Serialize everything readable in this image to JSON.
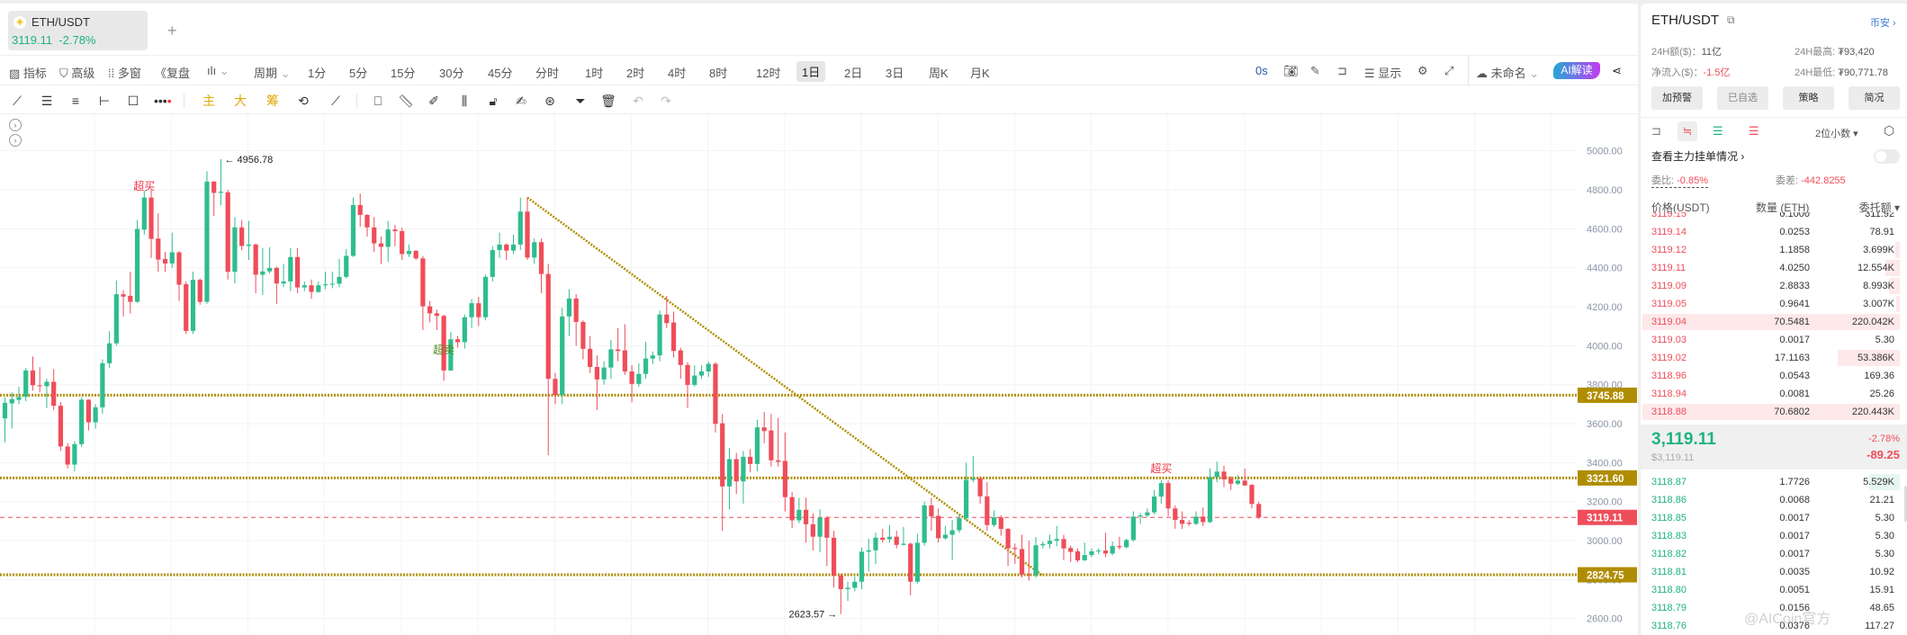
{
  "tab": {
    "symbol": "ETH/USDT",
    "price": "3119.11",
    "change": "-2.78%",
    "add": "+"
  },
  "toolbar1": {
    "indicators": "指标",
    "advanced": "高级",
    "multi_window": "多窗",
    "replay": "复盘",
    "period": "周期",
    "periods": [
      "1分",
      "5分",
      "15分",
      "30分",
      "45分",
      "分时",
      "1时",
      "2时",
      "4时",
      "8时",
      "12时",
      "1日",
      "2日",
      "3日",
      "周K",
      "月K"
    ],
    "selected_period": "1日",
    "countdown": "0s",
    "display": "显示",
    "layout_name": "未命名",
    "ai_button": "AI解读"
  },
  "toolbar2": {
    "main": "主",
    "big": "大",
    "chips": "筹"
  },
  "chart_data": {
    "type": "candlestick",
    "symbol": "ETH/USDT",
    "interval": "1日",
    "ylim": [
      2560,
      5060
    ],
    "yticks": [
      "5000.00",
      "4800.00",
      "4600.00",
      "4400.00",
      "4200.00",
      "4000.00",
      "3800.00",
      "3600.00",
      "3400.00",
      "3200.00",
      "3000.00",
      "2800.00",
      "2600.00"
    ],
    "ohlc": [
      [
        3627,
        3735,
        3505,
        3707
      ],
      [
        3704,
        3760,
        3575,
        3726
      ],
      [
        3722,
        3790,
        3700,
        3737
      ],
      [
        3738,
        3885,
        3715,
        3873
      ],
      [
        3873,
        3945,
        3770,
        3797
      ],
      [
        3797,
        3890,
        3760,
        3792
      ],
      [
        3792,
        3830,
        3680,
        3815
      ],
      [
        3815,
        3880,
        3670,
        3692
      ],
      [
        3692,
        3712,
        3460,
        3483
      ],
      [
        3483,
        3500,
        3370,
        3390
      ],
      [
        3390,
        3510,
        3355,
        3495
      ],
      [
        3495,
        3735,
        3480,
        3723
      ],
      [
        3723,
        3725,
        3565,
        3607
      ],
      [
        3607,
        3700,
        3575,
        3684
      ],
      [
        3684,
        3930,
        3650,
        3910
      ],
      [
        3910,
        4075,
        3885,
        4012
      ],
      [
        4012,
        4335,
        4000,
        4264
      ],
      [
        4264,
        4285,
        4150,
        4252
      ],
      [
        4256,
        4380,
        4165,
        4225
      ],
      [
        4225,
        4645,
        4220,
        4599
      ],
      [
        4595,
        4795,
        4570,
        4760
      ],
      [
        4760,
        4800,
        4450,
        4548
      ],
      [
        4550,
        4680,
        4380,
        4442
      ],
      [
        4445,
        4480,
        4380,
        4422
      ],
      [
        4422,
        4580,
        4400,
        4479
      ],
      [
        4479,
        4485,
        4230,
        4313
      ],
      [
        4316,
        4330,
        4060,
        4076
      ],
      [
        4076,
        4380,
        4060,
        4338
      ],
      [
        4338,
        4345,
        4210,
        4225
      ],
      [
        4225,
        4895,
        4215,
        4842
      ],
      [
        4842,
        4845,
        4665,
        4784
      ],
      [
        4784,
        4956.78,
        4720,
        4790
      ],
      [
        4787,
        4800,
        4340,
        4379
      ],
      [
        4379,
        4660,
        4320,
        4607
      ],
      [
        4607,
        4645,
        4490,
        4512
      ],
      [
        4512,
        4640,
        4440,
        4519
      ],
      [
        4519,
        4525,
        4270,
        4364
      ],
      [
        4364,
        4500,
        4260,
        4381
      ],
      [
        4381,
        4505,
        4370,
        4399
      ],
      [
        4399,
        4405,
        4215,
        4319
      ],
      [
        4319,
        4420,
        4300,
        4330
      ],
      [
        4330,
        4500,
        4280,
        4455
      ],
      [
        4455,
        4500,
        4270,
        4299
      ],
      [
        4299,
        4330,
        4280,
        4310
      ],
      [
        4310,
        4340,
        4240,
        4276
      ],
      [
        4276,
        4330,
        4270,
        4310
      ],
      [
        4310,
        4380,
        4290,
        4315
      ],
      [
        4315,
        4380,
        4295,
        4318
      ],
      [
        4318,
        4445,
        4300,
        4353
      ],
      [
        4353,
        4495,
        4345,
        4461
      ],
      [
        4461,
        4760,
        4455,
        4722
      ],
      [
        4722,
        4780,
        4610,
        4671
      ],
      [
        4671,
        4675,
        4560,
        4607
      ],
      [
        4607,
        4660,
        4480,
        4525
      ],
      [
        4525,
        4560,
        4420,
        4507
      ],
      [
        4507,
        4640,
        4430,
        4596
      ],
      [
        4596,
        4620,
        4510,
        4588
      ],
      [
        4588,
        4605,
        4440,
        4470
      ],
      [
        4470,
        4520,
        4455,
        4487
      ],
      [
        4487,
        4490,
        4440,
        4448
      ],
      [
        4448,
        4460,
        4080,
        4202
      ],
      [
        4202,
        4230,
        4120,
        4166
      ],
      [
        4166,
        4185,
        4080,
        4153
      ],
      [
        4153,
        4160,
        3820,
        3873
      ],
      [
        3873,
        4070,
        3870,
        4033
      ],
      [
        4033,
        4050,
        3990,
        4018
      ],
      [
        4018,
        4160,
        3985,
        4146
      ],
      [
        4146,
        4240,
        4090,
        4218
      ],
      [
        4218,
        4250,
        4100,
        4146
      ],
      [
        4146,
        4365,
        4130,
        4353
      ],
      [
        4353,
        4510,
        4330,
        4491
      ],
      [
        4491,
        4580,
        4450,
        4519
      ],
      [
        4519,
        4525,
        4440,
        4488
      ],
      [
        4488,
        4570,
        4470,
        4519
      ],
      [
        4519,
        4760,
        4490,
        4688
      ],
      [
        4688,
        4760,
        4440,
        4452
      ],
      [
        4452,
        4550,
        4420,
        4531
      ],
      [
        4531,
        4550,
        4270,
        4368
      ],
      [
        4368,
        4420,
        3438,
        3830
      ],
      [
        3830,
        3860,
        3700,
        3747
      ],
      [
        3747,
        4195,
        3700,
        4150
      ],
      [
        4150,
        4290,
        4050,
        4242
      ],
      [
        4242,
        4265,
        4000,
        4122
      ],
      [
        4122,
        4130,
        3930,
        3984
      ],
      [
        3984,
        4050,
        3860,
        3891
      ],
      [
        3891,
        3950,
        3670,
        3827
      ],
      [
        3827,
        3920,
        3800,
        3888
      ],
      [
        3888,
        4030,
        3830,
        3981
      ],
      [
        3981,
        4090,
        3920,
        3973
      ],
      [
        3976,
        4110,
        3850,
        3868
      ],
      [
        3868,
        3900,
        3710,
        3804
      ],
      [
        3804,
        3910,
        3790,
        3855
      ],
      [
        3855,
        4020,
        3830,
        3934
      ],
      [
        3934,
        3970,
        3905,
        3950
      ],
      [
        3950,
        4180,
        3920,
        4160
      ],
      [
        4160,
        4255,
        4090,
        4116
      ],
      [
        4119,
        4175,
        3940,
        3973
      ],
      [
        3976,
        3990,
        3830,
        3901
      ],
      [
        3901,
        3915,
        3680,
        3799
      ],
      [
        3799,
        3900,
        3790,
        3847
      ],
      [
        3847,
        3900,
        3830,
        3868
      ],
      [
        3868,
        3920,
        3840,
        3907
      ],
      [
        3907,
        3915,
        3555,
        3599
      ],
      [
        3602,
        3650,
        3050,
        3278
      ],
      [
        3278,
        3475,
        3160,
        3418
      ],
      [
        3418,
        3450,
        3240,
        3304
      ],
      [
        3304,
        3460,
        3190,
        3430
      ],
      [
        3430,
        3470,
        3350,
        3393
      ],
      [
        3393,
        3620,
        3355,
        3581
      ],
      [
        3581,
        3660,
        3500,
        3562
      ],
      [
        3565,
        3650,
        3380,
        3412
      ],
      [
        3412,
        3630,
        3380,
        3404
      ],
      [
        3409,
        3555,
        3150,
        3223
      ],
      [
        3223,
        3250,
        3065,
        3104
      ],
      [
        3104,
        3220,
        3090,
        3158
      ],
      [
        3158,
        3220,
        2990,
        3084
      ],
      [
        3084,
        3140,
        2950,
        3020
      ],
      [
        3020,
        3160,
        2940,
        3117
      ],
      [
        3117,
        3125,
        2870,
        3015
      ],
      [
        3015,
        3050,
        2760,
        2820
      ],
      [
        2820,
        2830,
        2623.57,
        2751
      ],
      [
        2751,
        2790,
        2690,
        2758
      ],
      [
        2758,
        2815,
        2740,
        2789
      ],
      [
        2789,
        2965,
        2750,
        2943
      ],
      [
        2943,
        3010,
        2840,
        2950
      ],
      [
        2950,
        3040,
        2880,
        3015
      ],
      [
        3015,
        3060,
        2990,
        3004
      ],
      [
        3007,
        3080,
        2990,
        3020
      ],
      [
        3020,
        3050,
        2960,
        2978
      ],
      [
        2978,
        3070,
        2975,
        2984
      ],
      [
        2984,
        2990,
        2720,
        2789
      ],
      [
        2789,
        3035,
        2780,
        2989
      ],
      [
        2989,
        3200,
        2975,
        3181
      ],
      [
        3181,
        3220,
        3050,
        3124
      ],
      [
        3127,
        3165,
        2990,
        3012
      ],
      [
        3012,
        3075,
        3005,
        3030
      ],
      [
        3030,
        3105,
        2900,
        3053
      ],
      [
        3053,
        3135,
        3040,
        3115
      ],
      [
        3115,
        3400,
        3100,
        3312
      ],
      [
        3312,
        3435,
        3300,
        3320
      ],
      [
        3320,
        3330,
        3190,
        3227
      ],
      [
        3227,
        3300,
        3050,
        3080
      ],
      [
        3080,
        3155,
        3070,
        3119
      ],
      [
        3119,
        3130,
        3025,
        3060
      ],
      [
        3060,
        3065,
        2870,
        2960
      ],
      [
        2963,
        2985,
        2880,
        2957
      ],
      [
        2957,
        3030,
        2810,
        2826
      ],
      [
        2826,
        3000,
        2795,
        2822
      ],
      [
        2822,
        3018,
        2810,
        2976
      ],
      [
        2976,
        2995,
        2960,
        2983
      ],
      [
        2983,
        3030,
        2960,
        2999
      ],
      [
        2999,
        3075,
        2970,
        3008
      ],
      [
        3008,
        3030,
        2900,
        2960
      ],
      [
        2962,
        2975,
        2890,
        2942
      ],
      [
        2945,
        2960,
        2890,
        2899
      ],
      [
        2899,
        2990,
        2895,
        2926
      ],
      [
        2926,
        2960,
        2915,
        2945
      ],
      [
        2945,
        2960,
        2930,
        2949
      ],
      [
        2949,
        3040,
        2915,
        2934
      ],
      [
        2934,
        2995,
        2925,
        2972
      ],
      [
        2972,
        3020,
        2955,
        2966
      ],
      [
        2966,
        3010,
        2960,
        3003
      ],
      [
        3003,
        3150,
        2995,
        3123
      ],
      [
        3123,
        3140,
        3085,
        3129
      ],
      [
        3129,
        3165,
        3120,
        3145
      ],
      [
        3145,
        3260,
        3135,
        3226
      ],
      [
        3226,
        3310,
        3190,
        3295
      ],
      [
        3295,
        3310,
        3125,
        3165
      ],
      [
        3165,
        3180,
        3060,
        3106
      ],
      [
        3106,
        3150,
        3060,
        3086
      ],
      [
        3092,
        3105,
        3075,
        3086
      ],
      [
        3086,
        3150,
        3080,
        3123
      ],
      [
        3123,
        3170,
        3075,
        3095
      ],
      [
        3095,
        3370,
        3090,
        3326
      ],
      [
        3326,
        3405,
        3300,
        3354
      ],
      [
        3354,
        3385,
        3275,
        3314
      ],
      [
        3318,
        3330,
        3260,
        3292
      ],
      [
        3292,
        3335,
        3285,
        3308
      ],
      [
        3308,
        3370,
        3280,
        3283
      ],
      [
        3286,
        3290,
        3165,
        3188
      ],
      [
        3188,
        3200,
        3110,
        3119.11
      ]
    ],
    "levels": [
      {
        "price": 3745.88,
        "label": "3745.88"
      },
      {
        "price": 3321.6,
        "label": "3321.60"
      },
      {
        "price": 2824.75,
        "label": "2824.75"
      }
    ],
    "last_price": {
      "price": 3119.11,
      "label": "3119.11"
    },
    "trendline": {
      "from": {
        "index": 75,
        "price": 4760
      },
      "to": {
        "index": 149,
        "price": 2820
      }
    },
    "high_marker": {
      "index": 31,
      "price": 4956.78,
      "label": "4956.78"
    },
    "low_marker": {
      "index": 120,
      "price": 2623.57,
      "label": "2623.57"
    },
    "signals": [
      {
        "index": 20,
        "price": 4800,
        "label": "超买",
        "kind": "overbought"
      },
      {
        "index": 63,
        "price": 3960,
        "label": "超卖",
        "kind": "oversold"
      },
      {
        "index": 166,
        "price": 3350,
        "label": "超买",
        "kind": "overbought"
      }
    ],
    "colors": {
      "up": "#2ebd8e",
      "down": "#ef4d5a",
      "level": "#b08d00",
      "last": "#ef4d5a"
    }
  },
  "panel": {
    "symbol": "ETH/USDT",
    "exchange": "币安",
    "vol_label": "24H额($)：",
    "vol": "11亿",
    "high_label": "24H最高:",
    "high": "₮93,420",
    "inflow_label": "净流入($)：",
    "inflow": "-1.5亿",
    "low_label": "24H最低:",
    "low": "₮90,771.78",
    "buttons": [
      "加预警",
      "已自选",
      "策略",
      "简况"
    ],
    "decimals": "2位小数",
    "main_orders": "查看主力挂单情况",
    "ratio_label": "委比:",
    "ratio": "-0.85%",
    "diff_label": "委差:",
    "diff": "-442.8255",
    "col_price": "价格(USDT)",
    "col_qty": "数量 (ETH)",
    "col_amount": "委托额",
    "asks": [
      {
        "price": "3119.15",
        "qty": "0.1000",
        "amount": "311.92",
        "depth": 0
      },
      {
        "price": "3119.14",
        "qty": "0.0253",
        "amount": "78.91",
        "depth": 0
      },
      {
        "price": "3119.12",
        "qty": "1.1858",
        "amount": "3.699K",
        "depth": 0.017
      },
      {
        "price": "3119.11",
        "qty": "4.0250",
        "amount": "12.554K",
        "depth": 0.057
      },
      {
        "price": "3119.09",
        "qty": "2.8833",
        "amount": "8.993K",
        "depth": 0.041
      },
      {
        "price": "3119.05",
        "qty": "0.9641",
        "amount": "3.007K",
        "depth": 0.014
      },
      {
        "price": "3119.04",
        "qty": "70.5481",
        "amount": "220.042K",
        "depth": 1
      },
      {
        "price": "3119.03",
        "qty": "0.0017",
        "amount": "5.30",
        "depth": 0
      },
      {
        "price": "3119.02",
        "qty": "17.1163",
        "amount": "53.386K",
        "depth": 0.242
      },
      {
        "price": "3118.96",
        "qty": "0.0543",
        "amount": "169.36",
        "depth": 0
      },
      {
        "price": "3118.94",
        "qty": "0.0081",
        "amount": "25.26",
        "depth": 0
      },
      {
        "price": "3118.88",
        "qty": "70.6802",
        "amount": "220.443K",
        "depth": 1
      }
    ],
    "last": {
      "price": "3,119.11",
      "usd": "$3,119.11",
      "change_pct": "-2.78%",
      "change": "-89.25"
    },
    "bids": [
      {
        "price": "3118.87",
        "qty": "1.7726",
        "amount": "5.529K",
        "depth": 0.12
      },
      {
        "price": "3118.86",
        "qty": "0.0068",
        "amount": "21.21",
        "depth": 0
      },
      {
        "price": "3118.85",
        "qty": "0.0017",
        "amount": "5.30",
        "depth": 0
      },
      {
        "price": "3118.83",
        "qty": "0.0017",
        "amount": "5.30",
        "depth": 0
      },
      {
        "price": "3118.82",
        "qty": "0.0017",
        "amount": "5.30",
        "depth": 0
      },
      {
        "price": "3118.81",
        "qty": "0.0035",
        "amount": "10.92",
        "depth": 0
      },
      {
        "price": "3118.80",
        "qty": "0.0051",
        "amount": "15.91",
        "depth": 0
      },
      {
        "price": "3118.79",
        "qty": "0.0156",
        "amount": "48.65",
        "depth": 0
      },
      {
        "price": "3118.76",
        "qty": "0.0376",
        "amount": "117.27",
        "depth": 0
      }
    ],
    "watermark": "@AICoin官方"
  }
}
